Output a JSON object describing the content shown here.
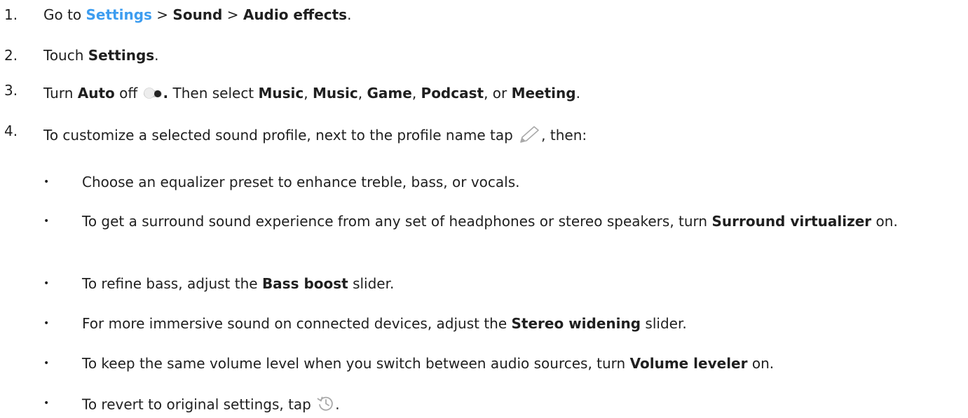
{
  "steps": [
    {
      "num": "1.",
      "pre": "Go to ",
      "link": "Settings",
      "sep1": " > ",
      "b1": "Sound",
      "sep2": " > ",
      "b2": "Audio effects",
      "post": "."
    },
    {
      "num": "2.",
      "pre": "Touch ",
      "b1": "Settings",
      "post": "."
    },
    {
      "num": "3.",
      "pre": "Turn ",
      "b1": "Auto",
      "mid1": " off ",
      "dot": ".",
      "mid2": " Then select ",
      "o1": "Music",
      "c1": ", ",
      "o2": "Music",
      "c2": ", ",
      "o3": "Game",
      "c3": ", ",
      "o4": "Podcast",
      "c4": ", or ",
      "o5": "Meeting",
      "post": "."
    },
    {
      "num": "4.",
      "pre": "To customize a selected sound profile, next to the profile name tap ",
      "post": ", then:"
    }
  ],
  "bullets": [
    {
      "text": "Choose an equalizer preset to enhance treble, bass, or vocals."
    },
    {
      "pre": "To get a surround sound experience from any set of headphones or stereo speakers, turn ",
      "bold": "Surround virtualizer",
      "post": " on."
    },
    {
      "pre": "To refine bass, adjust the ",
      "bold": "Bass boost",
      "post": " slider."
    },
    {
      "pre": "For more immersive sound on connected devices, adjust the ",
      "bold": "Stereo widening",
      "post": " slider."
    },
    {
      "pre": "To keep the same volume level when you switch between audio sources, turn ",
      "bold": "Volume leveler",
      "post": " on."
    },
    {
      "pre": "To revert to original settings, tap ",
      "post": "."
    }
  ],
  "bullet_char": "•",
  "icons": {
    "toggle": "toggle-off-icon",
    "edit": "pencil-icon",
    "reset": "history-icon"
  },
  "colors": {
    "link": "#3d9df0",
    "text": "#1f1f1f",
    "icon": "#9e9e9e"
  }
}
